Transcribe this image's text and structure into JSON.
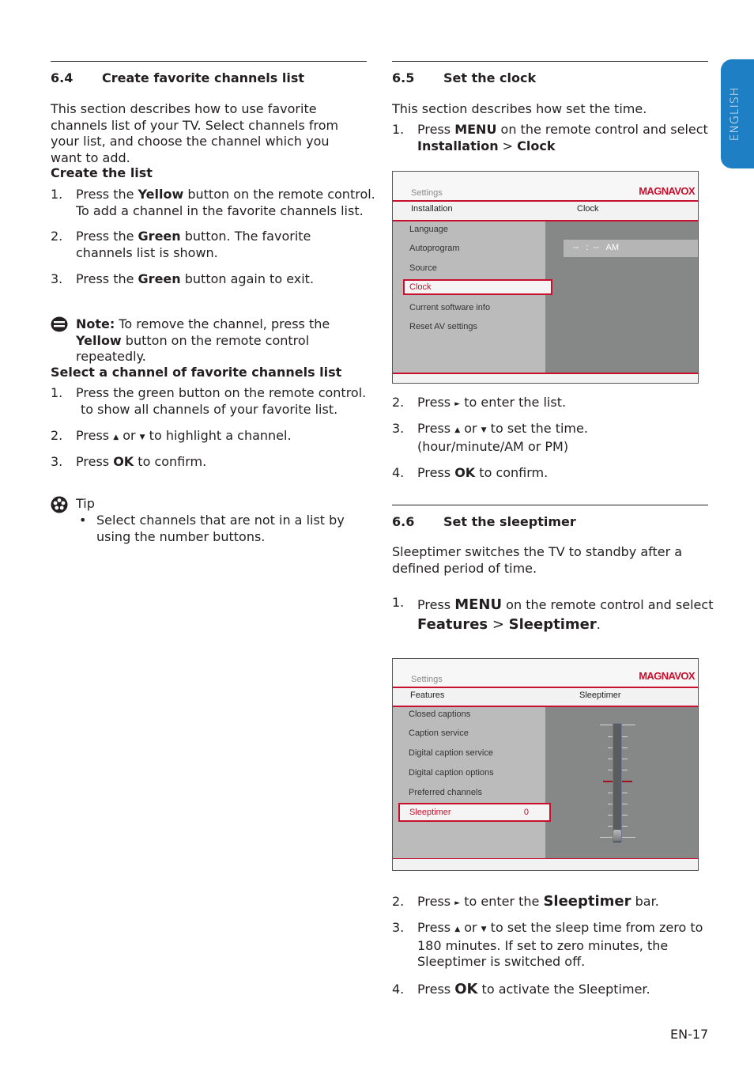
{
  "side_tab": {
    "label": "ENGLISH",
    "color": "#1f7fc4"
  },
  "page_number": "EN-17",
  "sections": {
    "s64": {
      "number": "6.4",
      "title": "Create favorite channels list",
      "intro": "This section describes how to use favorite channels list of your TV. Select channels from your list, and choose the channel which you want to add.",
      "create_list": {
        "heading": "Create the list",
        "steps": [
          {
            "n": "1.",
            "pre": "Press the ",
            "bold": "Yellow",
            "post": " button on the remote control. To add a channel in the favorite channels list."
          },
          {
            "n": "2.",
            "pre": "Press the ",
            "bold": "Green",
            "post": " button. The favorite channels list is shown."
          },
          {
            "n": "3.",
            "pre": "Press the ",
            "bold": "Green",
            "post": " button again to exit."
          }
        ]
      },
      "note": {
        "label": "Note:",
        "pre": " To remove the channel, press the ",
        "bold": "Yellow",
        "post": " button on the remote control repeatedly."
      },
      "select_channel": {
        "heading": "Select a channel of favorite channels list",
        "steps": [
          {
            "n": "1.",
            "text": "Press the green button on the remote control.",
            "text2": "to show all channels of your favorite list."
          },
          {
            "n": "2.",
            "pre": "Press ",
            "up": "▲",
            "mid": " or ",
            "down": "▼",
            "post": " to highlight a channel."
          },
          {
            "n": "3.",
            "pre": "Press ",
            "bold": "OK",
            "post": " to confirm."
          }
        ]
      },
      "tip": {
        "label": "Tip",
        "bullet": "•",
        "text": "Select channels that are not in a list by using the number buttons."
      }
    },
    "s65": {
      "number": "6.5",
      "title": "Set the clock",
      "intro": "This section describes how set the time.",
      "steps": [
        {
          "n": "1.",
          "pre": "Press ",
          "bold": "MENU",
          "post": " on the remote control and select",
          "line2_a": "Installation",
          "line2_sep": " > ",
          "line2_b": "Clock"
        },
        {
          "n": "2.",
          "pre": "Press ",
          "right": "►",
          "post": " to enter the list."
        },
        {
          "n": "3.",
          "pre": "Press ",
          "up": "▲",
          "mid": " or ",
          "down": "▼",
          "post": " to set the time.",
          "line2": "(hour/minute/AM or PM)"
        },
        {
          "n": "4.",
          "pre": "Press ",
          "bold": "OK",
          "post": " to confirm."
        }
      ],
      "screen": {
        "settings_label": "Settings",
        "brand": "MAGNAVOX",
        "crumb_left": "Installation",
        "crumb_right": "Clock",
        "menu_items": [
          "Language",
          "Autoprogram",
          "Source",
          "Clock",
          "Current software info",
          "Reset AV settings"
        ],
        "selected_item": "Clock",
        "time_value": "--   :  --   AM"
      }
    },
    "s66": {
      "number": "6.6",
      "title": "Set the sleeptimer",
      "intro": "Sleeptimer switches the TV to standby after a defined period of time.",
      "steps": [
        {
          "n": "1.",
          "pre": "Press ",
          "bold": "MENU",
          "post": " on the remote control and select",
          "line2_a": "Features",
          "line2_sep": " > ",
          "line2_b": "Sleeptimer",
          "line2_end": "."
        },
        {
          "n": "2.",
          "pre": "Press ",
          "right": "►",
          "mid": " to enter the ",
          "bold": "Sleeptimer",
          "post": " bar."
        },
        {
          "n": "3.",
          "pre": "Press ",
          "up": "▲",
          "mid": " or ",
          "down": "▼",
          "post": " to set the sleep time from zero to",
          "line2": "180 minutes. If set to zero minutes, the",
          "line3": "Sleeptimer is switched off."
        },
        {
          "n": "4.",
          "pre": "Press ",
          "bold": "OK",
          "post": " to activate the Sleeptimer."
        }
      ],
      "screen": {
        "settings_label": "Settings",
        "brand": "MAGNAVOX",
        "crumb_left": "Features",
        "crumb_right": "Sleeptimer",
        "menu_items": [
          "Closed captions",
          "Caption service",
          "Digital caption service",
          "Digital caption options",
          "Preferred channels",
          "Sleeptimer"
        ],
        "selected_item": "Sleeptimer",
        "selected_value": "0",
        "slider_level": 0
      }
    }
  }
}
